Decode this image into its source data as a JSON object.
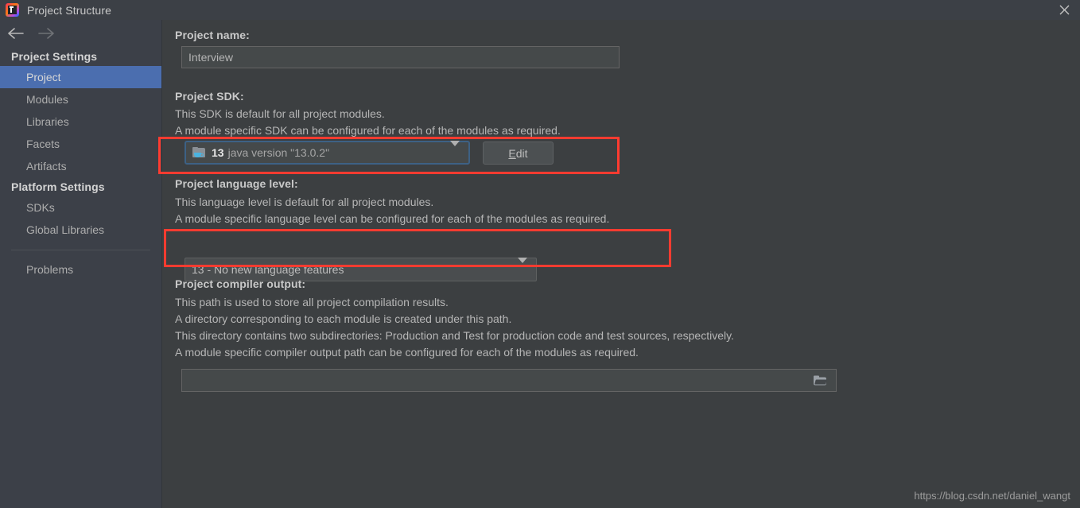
{
  "window": {
    "title": "Project Structure",
    "logo_icon": "intellij-idea-logo",
    "close_icon": "close-icon"
  },
  "nav": {
    "back_icon": "arrow-left-icon",
    "forward_icon": "arrow-right-icon"
  },
  "sidebar": {
    "groups": [
      {
        "header": "Project Settings",
        "items": [
          {
            "label": "Project",
            "selected": true
          },
          {
            "label": "Modules",
            "selected": false
          },
          {
            "label": "Libraries",
            "selected": false
          },
          {
            "label": "Facets",
            "selected": false
          },
          {
            "label": "Artifacts",
            "selected": false
          }
        ]
      },
      {
        "header": "Platform Settings",
        "items": [
          {
            "label": "SDKs",
            "selected": false
          },
          {
            "label": "Global Libraries",
            "selected": false
          }
        ]
      }
    ],
    "problems": {
      "label": "Problems"
    }
  },
  "main": {
    "project_name": {
      "label": "Project name:",
      "value": "Interview"
    },
    "project_sdk": {
      "label": "Project SDK:",
      "desc_1": "This SDK is default for all project modules.",
      "desc_2": "A module specific SDK can be configured for each of the modules as required.",
      "sdk_icon": "jdk-folder-icon",
      "sdk_version": "13",
      "sdk_description": "java version \"13.0.2\"",
      "dropdown_icon": "chevron-down-icon",
      "edit_button": {
        "mnemonic": "E",
        "rest": "dit"
      }
    },
    "language_level": {
      "label": "Project language level:",
      "desc_1": "This language level is default for all project modules.",
      "desc_2": "A module specific language level can be configured for each of the modules as required.",
      "value": "13 - No new language features",
      "dropdown_icon": "chevron-down-icon"
    },
    "compiler_output": {
      "label": "Project compiler output:",
      "desc_1": "This path is used to store all project compilation results.",
      "desc_2": "A directory corresponding to each module is created under this path.",
      "desc_3": "This directory contains two subdirectories: Production and Test for production code and test sources, respectively.",
      "desc_4": "A module specific compiler output path can be configured for each of the modules as required.",
      "value": "",
      "placeholder": "",
      "browse_icon": "folder-browse-icon"
    }
  },
  "watermark": "https://blog.csdn.net/daniel_wangt",
  "colors": {
    "accent_selected": "#4b6eaf",
    "annotation_red": "#ff3b30",
    "panel_bg": "#3c3f41",
    "sidebar_bg": "#3c4048",
    "focus_border": "#3d6185"
  }
}
